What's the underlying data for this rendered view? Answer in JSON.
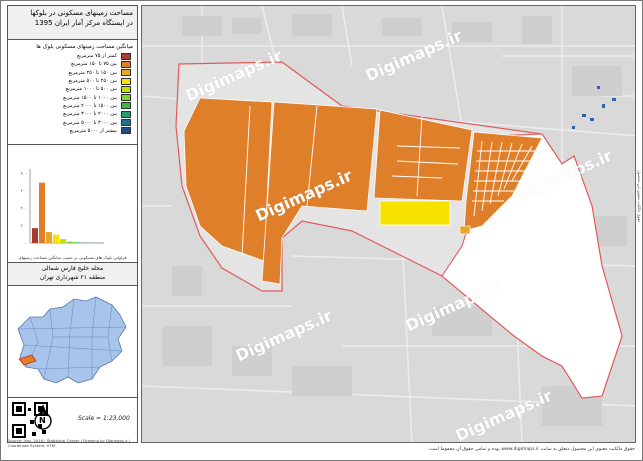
{
  "title": {
    "line1": "مساحت زمینهای مسکونی در بلوکها",
    "line2": "در ایستگاه مرکز آمار ایران 1395"
  },
  "legend": {
    "heading": "میانگین مساحت زمینهای مسکونی بلوک ها",
    "items": [
      {
        "label": "کمتر از ۷۵ مترمربع",
        "color": "#a83a2e"
      },
      {
        "label": "بین ۷۵ تا ۱۵۰ مترمربع",
        "color": "#e07f2a"
      },
      {
        "label": "بین ۱۵۰ تا ۲۵۰ مترمربع",
        "color": "#e8a52a"
      },
      {
        "label": "بین ۲۵۰ تا ۵۰۰ مترمربع",
        "color": "#f7e200"
      },
      {
        "label": "بین ۵۰۰ تا ۱۰۰۰ مترمربع",
        "color": "#c4e000"
      },
      {
        "label": "بین ۱۰۰۰ تا ۱۵۰۰ مترمربع",
        "color": "#7cd42e"
      },
      {
        "label": "بین ۱۵۰۰ تا ۲۰۰۰ مترمربع",
        "color": "#39b54a"
      },
      {
        "label": "بین ۲۰۰۰ تا ۳۰۰۰ مترمربع",
        "color": "#1f9e6a"
      },
      {
        "label": "بین ۳۰۰۰ تا ۵۰۰۰ مترمربع",
        "color": "#1e7090"
      },
      {
        "label": "بیشتر از ۵۰۰۰ مترمربع",
        "color": "#1e4d8a"
      }
    ]
  },
  "chart_data": {
    "type": "bar",
    "categories": [
      "1",
      "2",
      "3",
      "4",
      "5",
      "6",
      "7",
      "8",
      "9",
      "10"
    ],
    "values": [
      170,
      690,
      125,
      95,
      45,
      15,
      8,
      4,
      2,
      1
    ],
    "colors": [
      "#a83a2e",
      "#e07f2a",
      "#e8a52a",
      "#f7e200",
      "#c4e000",
      "#7cd42e",
      "#39b54a",
      "#1f9e6a",
      "#1e7090",
      "#1e4d8a"
    ],
    "yticks": [
      "۸۰۰",
      "۶۰۰",
      "۴۰۰",
      "۲۰۰",
      "۰"
    ],
    "ylim": [
      0,
      800
    ],
    "note": "فراوانی بلوک های مسکونی بر حسب میانگین مساحت زمینهای مسکونی در کل شهر تهران"
  },
  "location": {
    "line1": "محله خلیج فارس شمالی",
    "line2": "منطقه ۲۱ شهرداری تهران"
  },
  "scale_text": "Scale = 1:23,000",
  "north_label": "N",
  "credit": "Source: Iran, 2016 | Statistical Center / Drawing by Digimaps.ir | Coordinate System: UTM",
  "watermark": "Digimaps.ir",
  "footer": "حقوق مالکیت معنوی این محصول متعلق به سایت www.digimaps.ir بوده و تمامی حقوق آن محفوظ است.",
  "side_note": "حقوق مالکیت معنوی این محصول"
}
